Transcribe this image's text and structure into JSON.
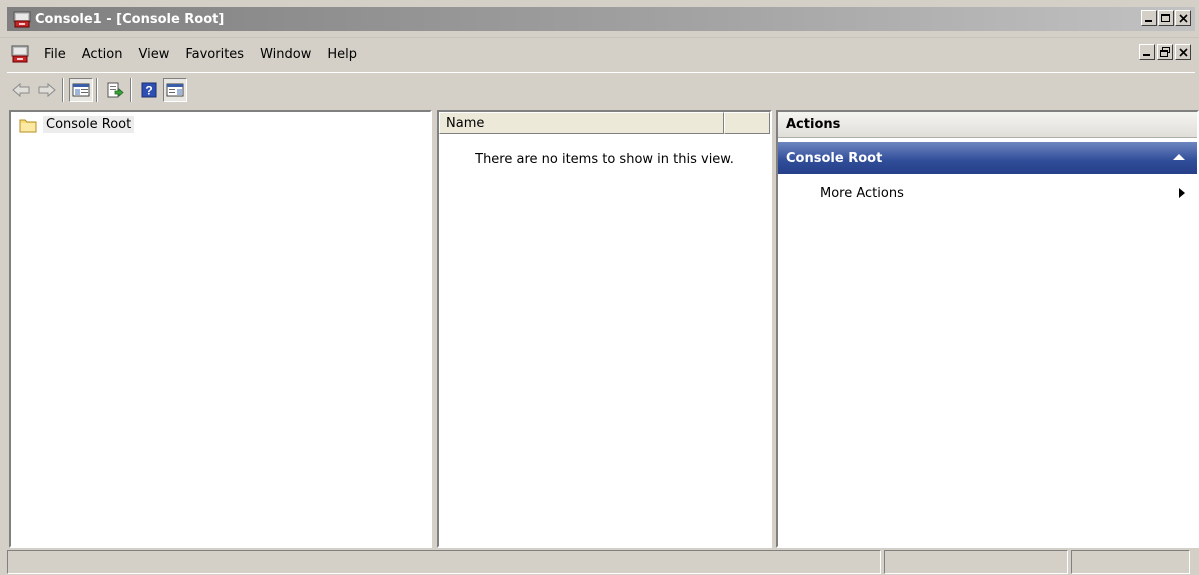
{
  "window": {
    "title": "Console1 - [Console Root]",
    "controls": [
      "minimize-icon",
      "maximize-icon",
      "close-icon"
    ]
  },
  "menu": {
    "items": [
      "File",
      "Action",
      "View",
      "Favorites",
      "Window",
      "Help"
    ],
    "mdi_controls": [
      "minimize-icon",
      "restore-icon",
      "close-icon"
    ]
  },
  "toolbar": {
    "buttons": [
      "back-icon",
      "forward-icon",
      "show-hide-console-tree-icon",
      "export-list-icon",
      "help-icon",
      "show-hide-action-pane-icon"
    ]
  },
  "tree": {
    "root_label": "Console Root"
  },
  "list": {
    "columns": [
      "Name",
      ""
    ],
    "empty_message": "There are no items to show in this view."
  },
  "actions": {
    "header": "Actions",
    "section_title": "Console Root",
    "items": [
      "More Actions"
    ]
  },
  "colors": {
    "section_blue": "#2f4c98",
    "chrome": "#d4d0c8"
  }
}
